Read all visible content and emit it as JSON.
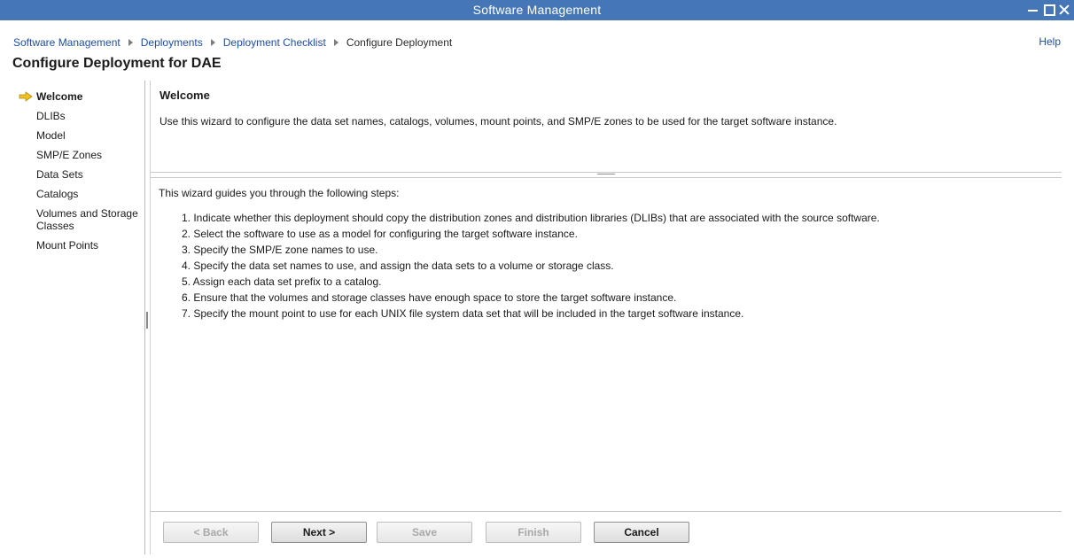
{
  "window": {
    "title": "Software Management"
  },
  "breadcrumb": {
    "items": [
      "Software Management",
      "Deployments",
      "Deployment Checklist"
    ],
    "current": "Configure Deployment"
  },
  "help_label": "Help",
  "page_title": "Configure Deployment for DAE",
  "nav": {
    "items": [
      {
        "label": "Welcome",
        "active": true
      },
      {
        "label": "DLIBs"
      },
      {
        "label": "Model"
      },
      {
        "label": "SMP/E Zones"
      },
      {
        "label": "Data Sets"
      },
      {
        "label": "Catalogs"
      },
      {
        "label": "Volumes and Storage Classes"
      },
      {
        "label": "Mount Points"
      }
    ],
    "active_icon": "arrow-right-icon",
    "active_icon_color": "#f2c21b"
  },
  "welcome": {
    "heading": "Welcome",
    "description": "Use this wizard to configure the data set names, catalogs, volumes, mount points, and SMP/E zones to be used for the target software instance."
  },
  "steps": {
    "intro": "This wizard guides you through the following steps:",
    "items": [
      "1. Indicate whether this deployment should copy the distribution zones and distribution libraries (DLIBs) that are associated with the source software.",
      "2. Select the software to use as a model for configuring the target software instance.",
      "3. Specify the SMP/E zone names to use.",
      "4. Specify the data set names to use, and assign the data sets to a volume or storage class.",
      "5. Assign each data set prefix to a catalog.",
      "6. Ensure that the volumes and storage classes have enough space to store the target software instance.",
      "7. Specify the mount point to use for each UNIX file system data set that will be included in the target software instance."
    ]
  },
  "buttons": {
    "back": "< Back",
    "next": "Next >",
    "save": "Save",
    "finish": "Finish",
    "cancel": "Cancel"
  },
  "colors": {
    "titlebar": "#4577b7",
    "link": "#1f4fa0"
  }
}
